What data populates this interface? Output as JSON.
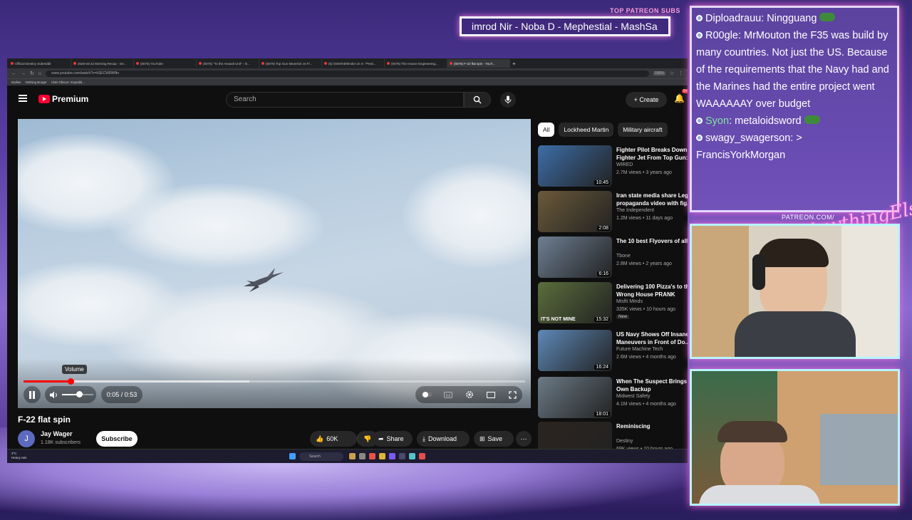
{
  "overlay": {
    "top_label": "TOP PATREON SUBS",
    "ticker_text": "imrod Nir - Noba D - Mephestial - MashSa",
    "patreon_url": "PATREON.COM/",
    "patreon_brand": "AnythingElse"
  },
  "browser": {
    "tabs": [
      {
        "label": "Official Destiny Subreddit"
      },
      {
        "label": "2026-03-22 Morning Recap - Ge..."
      },
      {
        "label": "(6076) YouTube"
      },
      {
        "label": "(6076) \"To the Assault Unit\" - D..."
      },
      {
        "label": "(6076) Top Gun Maverick vs F/..."
      },
      {
        "label": "(5) OSINTdefender on X: \"Presi..."
      },
      {
        "label": "(6076) The Insane Engineering..."
      },
      {
        "label": "(6076) F-22 flat spin - YouT..."
      }
    ],
    "new_tab_symbol": "+",
    "url": "www.youtube.com/watch?v=kSECWl9Wfto",
    "zoom": "160%",
    "bookmarks": [
      "Dailies",
      "Nothing Burger",
      "Clair Obscur: Expediti..."
    ]
  },
  "youtube": {
    "brand": "Premium",
    "search_placeholder": "Search",
    "create_label": "Create",
    "notif_count": "9+",
    "video": {
      "title": "F-22 flat spin",
      "time": "0:05 / 0:53",
      "progress": 0.0943,
      "buffered": 0.45,
      "volume": 0.55,
      "tooltip": "Volume"
    },
    "channel": {
      "name": "Jay Wager",
      "initial": "J",
      "subs": "1.18K subscribers"
    },
    "subscribe_label": "Subscribe",
    "actions": {
      "likes": "60K",
      "share": "Share",
      "download": "Download",
      "save": "Save"
    },
    "chips": [
      "All",
      "Lockheed Martin",
      "Military aircraft"
    ],
    "recommendations": [
      {
        "title": "Fighter Pilot Breaks Down Fighter Jet From Top Gun:",
        "channel": "WIRED",
        "meta": "2.7M views • 3 years ago",
        "duration": "10:45",
        "color": "#3d6ea8",
        "new": ""
      },
      {
        "title": "Iran state media share Lego propaganda video with fig...",
        "channel": "The Independent",
        "meta": "1.2M views • 11 days ago",
        "duration": "2:08",
        "color": "#6b5a3a",
        "new": ""
      },
      {
        "title": "The 10 best Flyovers of all",
        "channel": "Tbone",
        "meta": "2.8M views • 2 years ago",
        "duration": "6:16",
        "color": "#6e7f93",
        "new": ""
      },
      {
        "title": "Delivering 100 Pizza's to the Wrong House PRANK",
        "channel": "Misfit Minds",
        "meta": "335K views • 10 hours ago",
        "duration": "15:32",
        "color": "#5a6e3c",
        "new": "New"
      },
      {
        "title": "US Navy Shows Off Insane Maneuvers in Front of Do...",
        "channel": "Future Machine Tech",
        "meta": "2.6M views • 4 months ago",
        "duration": "16:24",
        "color": "#5d89b8",
        "new": ""
      },
      {
        "title": "When The Suspect Brings Own Backup",
        "channel": "Midwest Safety",
        "meta": "4.1M views • 4 months ago",
        "duration": "18:01",
        "color": "#6b7a86",
        "new": ""
      },
      {
        "title": "Reminiscing",
        "channel": "Destiny",
        "meta": "69K views • 10 hours ago",
        "duration": "",
        "color": "#2b2420",
        "new": ""
      }
    ],
    "thumb_caption": "IT'S NOT MINE"
  },
  "taskbar": {
    "weather": "3°C",
    "weather_desc": "Heavy rain",
    "search": "Search"
  },
  "chat": [
    {
      "user": "Diploadrauu",
      "text": "Ningguang",
      "green": false
    },
    {
      "user": "R00gle",
      "text": "MrMouton the F35 was build by many countries. Not just the US. Because of the requirements that the Navy had and the Marines had the entire project went WAAAAAAY over budget",
      "green": false
    },
    {
      "user": "Syon",
      "text": "metaloidsword",
      "green": true
    },
    {
      "user": "swagy_swagerson",
      "text": "> FrancisYorkMorgan",
      "green": false
    }
  ]
}
